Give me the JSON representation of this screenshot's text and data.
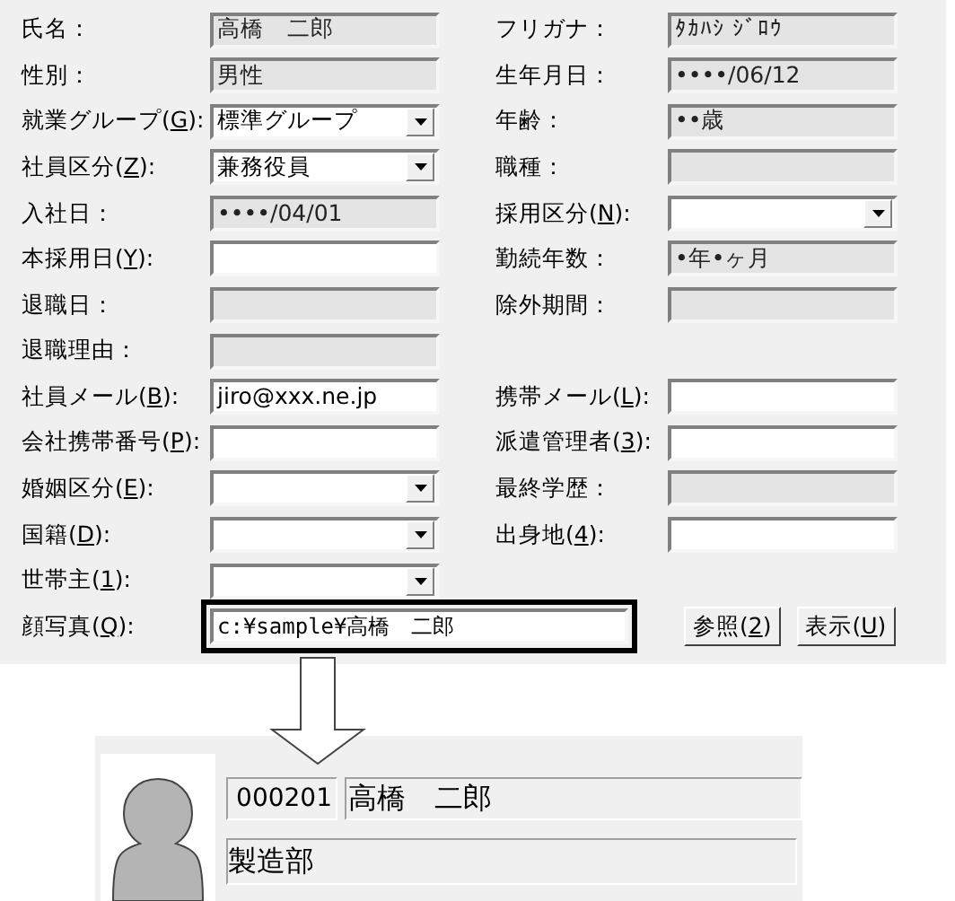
{
  "form": {
    "rows": [
      {
        "left": {
          "label_pre": "氏名：",
          "kind": "text",
          "disabled": true,
          "value": "高橋　二郎"
        },
        "right": {
          "label_pre": "フリガナ：",
          "kind": "text",
          "disabled": true,
          "value": "ﾀｶﾊｼ ｼﾞﾛｳ"
        }
      },
      {
        "left": {
          "label_pre": "性別：",
          "kind": "text",
          "disabled": true,
          "value": "男性"
        },
        "right": {
          "label_pre": "生年月日：",
          "kind": "text",
          "disabled": true,
          "value": "••••/06/12"
        }
      },
      {
        "left": {
          "label_pre": "就業グループ(",
          "accel": "G",
          "label_post": "):",
          "kind": "select",
          "disabled": false,
          "value": "標準グループ"
        },
        "right": {
          "label_pre": "年齢：",
          "kind": "text",
          "disabled": true,
          "value": "••歳"
        }
      },
      {
        "left": {
          "label_pre": "社員区分(",
          "accel": "Z",
          "label_post": "):",
          "kind": "select",
          "disabled": false,
          "value": "兼務役員"
        },
        "right": {
          "label_pre": "職種：",
          "kind": "text",
          "disabled": true
        }
      },
      {
        "left": {
          "label_pre": "入社日：",
          "kind": "text",
          "disabled": true,
          "value": "••••/04/01"
        },
        "right": {
          "label_pre": "採用区分(",
          "accel": "N",
          "label_post": "):",
          "kind": "select",
          "disabled": false
        }
      },
      {
        "left": {
          "label_pre": "本採用日(",
          "accel": "Y",
          "label_post": "):",
          "kind": "text",
          "disabled": false
        },
        "right": {
          "label_pre": "勤続年数：",
          "kind": "text",
          "disabled": true,
          "value": "•年•ヶ月"
        }
      },
      {
        "left": {
          "label_pre": "退職日：",
          "kind": "text",
          "disabled": true
        },
        "right": {
          "label_pre": "除外期間：",
          "kind": "text",
          "disabled": true
        }
      },
      {
        "left": {
          "label_pre": "退職理由：",
          "kind": "text",
          "disabled": true
        }
      },
      {
        "left": {
          "label_pre": "社員メール(",
          "accel": "B",
          "label_post": "):",
          "kind": "text",
          "disabled": false,
          "value": "jiro@xxx.ne.jp"
        },
        "right": {
          "label_pre": "携帯メール(",
          "accel": "L",
          "label_post": "):",
          "kind": "text",
          "disabled": false
        }
      },
      {
        "left": {
          "label_pre": "会社携帯番号(",
          "accel": "P",
          "label_post": "):",
          "kind": "text",
          "disabled": false
        },
        "right": {
          "label_pre": "派遣管理者(",
          "accel": "3",
          "label_post": "):",
          "kind": "text",
          "disabled": false
        }
      },
      {
        "left": {
          "label_pre": "婚姻区分(",
          "accel": "E",
          "label_post": "):",
          "kind": "select",
          "disabled": false
        },
        "right": {
          "label_pre": "最終学歴：",
          "kind": "text",
          "disabled": true
        }
      },
      {
        "left": {
          "label_pre": "国籍(",
          "accel": "D",
          "label_post": "):",
          "kind": "select",
          "disabled": false
        },
        "right": {
          "label_pre": "出身地(",
          "accel": "4",
          "label_post": "):",
          "kind": "text",
          "disabled": false
        }
      },
      {
        "left": {
          "label_pre": "世帯主(",
          "accel": "1",
          "label_post": "):",
          "kind": "select",
          "disabled": false
        }
      }
    ],
    "photo": {
      "label_pre": "顔写真(",
      "accel": "Q",
      "label_post": "):",
      "value": "c:¥sample¥高橋　二郎",
      "highlighted": true,
      "buttons": [
        {
          "label_pre": "参照(",
          "accel": "2",
          "label_post": ")"
        },
        {
          "label_pre": "表示(",
          "accel": "U",
          "label_post": ")"
        }
      ]
    }
  },
  "card": {
    "code": "000201",
    "name": "高橋　二郎",
    "department": "製造部"
  }
}
